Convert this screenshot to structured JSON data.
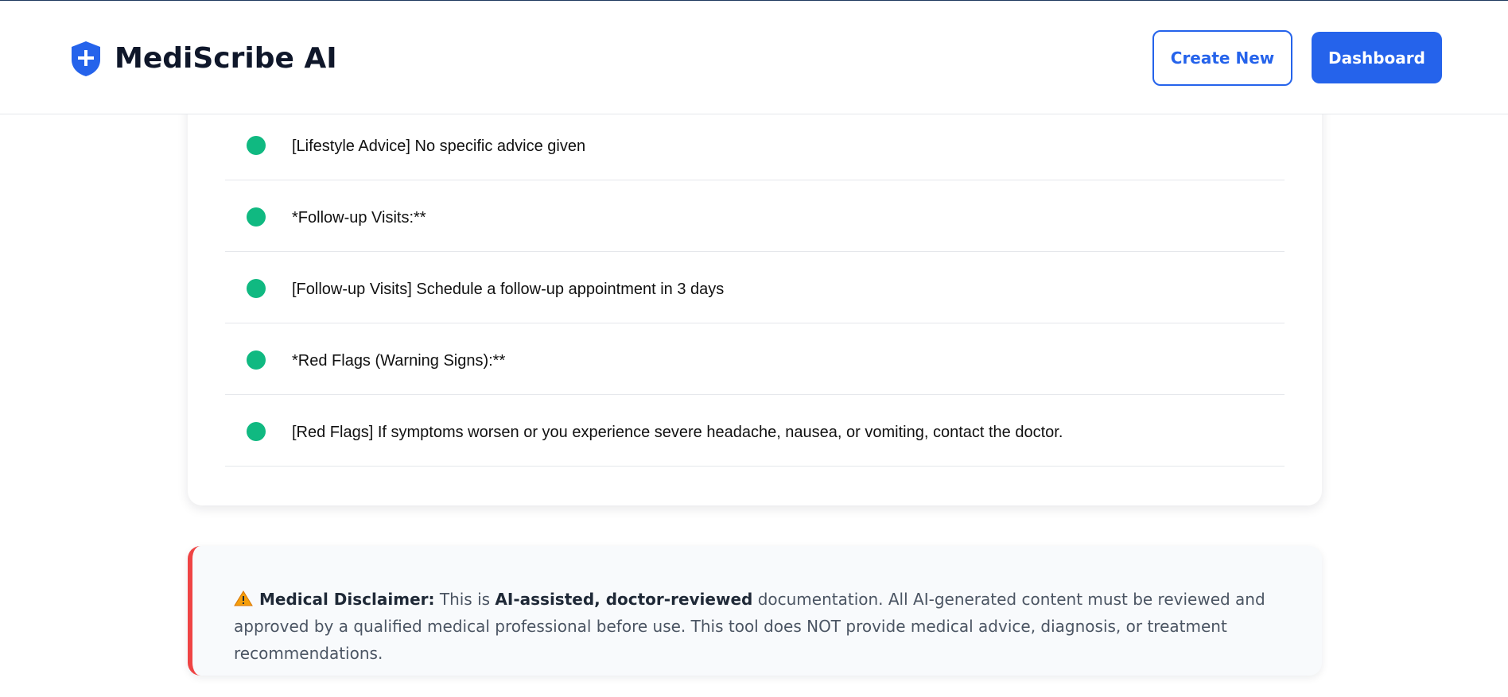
{
  "header": {
    "brand": "MediScribe AI",
    "create_new_label": "Create New",
    "dashboard_label": "Dashboard"
  },
  "plan_items": [
    {
      "text": "[Lifestyle Advice] No specific advice given"
    },
    {
      "text": "*Follow-up Visits:**"
    },
    {
      "text": "[Follow-up Visits] Schedule a follow-up appointment in 3 days"
    },
    {
      "text": "*Red Flags (Warning Signs):**"
    },
    {
      "text": "[Red Flags] If symptoms worsen or you experience severe headache, nausea, or vomiting, contact the doctor."
    }
  ],
  "disclaimer": {
    "label": "Medical Disclaimer:",
    "text_before": "This is",
    "emphasis": "AI-assisted, doctor-reviewed",
    "text_after": "documentation. All AI-generated content must be reviewed and approved by a qualified medical professional before use. This tool does NOT provide medical advice, diagnosis, or treatment recommendations."
  },
  "colors": {
    "primary": "#2563eb",
    "bullet": "#10b981",
    "disclaimer_border": "#ef4444",
    "warning": "#f59e0b"
  },
  "icons": {
    "logo": "shield-plus-icon",
    "bullet": "dot-icon",
    "warning": "warning-icon"
  }
}
